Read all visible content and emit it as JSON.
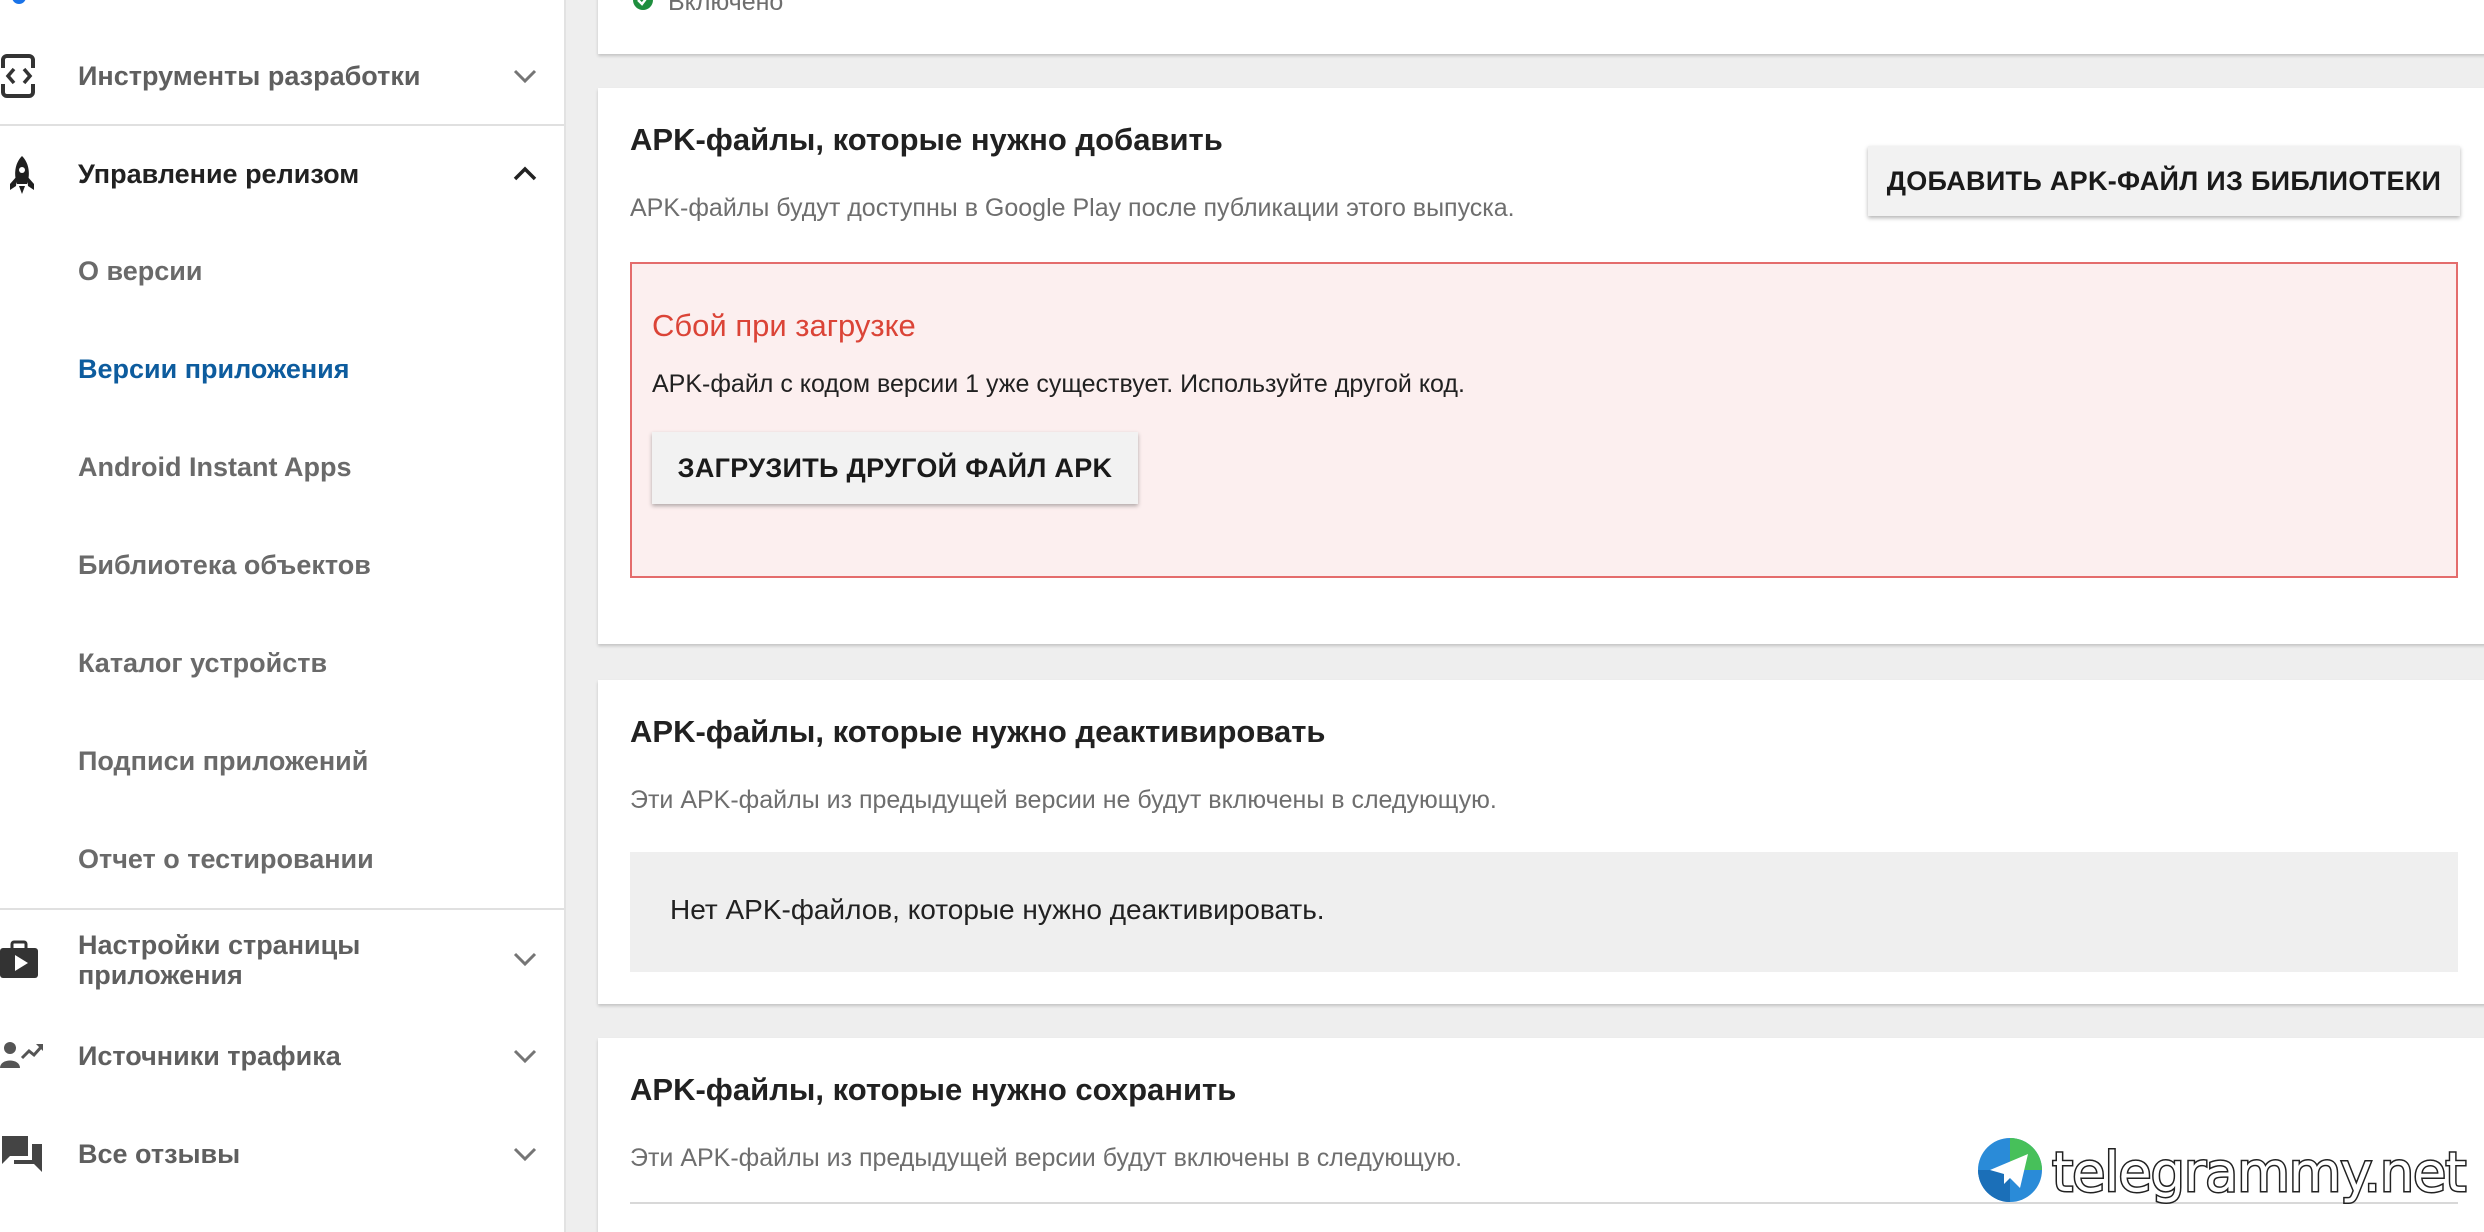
{
  "sidebar": {
    "sections": {
      "dev_tools": "Инструменты разработки",
      "release_mgmt": "Управление релизом",
      "store_settings_line1": "Настройки страницы",
      "store_settings_line2": "приложения",
      "traffic": "Источники трафика",
      "reviews": "Все отзывы"
    },
    "release_items": [
      "О версии",
      "Версии приложения",
      "Android Instant Apps",
      "Библиотека объектов",
      "Каталог устройств",
      "Подписи приложений",
      "Отчет о тестировании"
    ],
    "active_item": "Версии приложения",
    "active_color": "#0d5c9e"
  },
  "status": {
    "enabled_label": "Включено"
  },
  "add_card": {
    "title": "APK-файлы, которые нужно добавить",
    "description": "APK-файлы будут доступны в Google Play после публикации этого выпуска.",
    "library_button": "ДОБАВИТЬ APK-ФАЙЛ ИЗ БИБЛИОТЕКИ",
    "error": {
      "title": "Сбой при загрузке",
      "message": "APK-файл с кодом версии 1 уже существует. Используйте другой код.",
      "button": "ЗАГРУЗИТЬ ДРУГОЙ ФАЙЛ APK",
      "color": "#db4437"
    }
  },
  "deactivate_card": {
    "title": "APK-файлы, которые нужно деактивировать",
    "description": "Эти APK-файлы из предыдущей версии не будут включены в следующую.",
    "empty_text": "Нет APK-файлов, которые нужно деактивировать."
  },
  "retain_card": {
    "title": "APK-файлы, которые нужно сохранить",
    "description": "Эти APK-файлы из предыдущей версии будут включены в следующую."
  },
  "watermark": {
    "text": "telegrammy.net"
  },
  "icons": {
    "dev_tools": "code-icon",
    "release": "rocket-icon",
    "store": "store-play-icon",
    "traffic": "trending-users-icon",
    "reviews": "chat-icon",
    "status": "check-circle-icon"
  }
}
